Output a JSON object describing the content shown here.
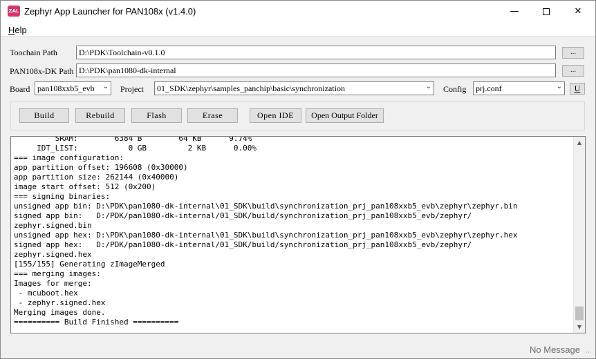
{
  "window": {
    "title": "Zephyr App Launcher for PAN108x (v1.4.0)",
    "icon_text": "ZAL",
    "icon_color": "#d6336c"
  },
  "menu": {
    "help_prefix": "H",
    "help_rest": "elp"
  },
  "toolchain": {
    "label": "Toochain Path",
    "value": "D:\\PDK\\Toolchain-v0.1.0",
    "browse": "..."
  },
  "pdk": {
    "label": "PAN108x-DK Path",
    "value": "D:\\PDK\\pan1080-dk-internal",
    "browse": "..."
  },
  "board": {
    "label": "Board",
    "value": "pan108xxb5_evb"
  },
  "project": {
    "label": "Project",
    "value": "01_SDK\\zephyr\\samples_panchip\\basic\\synchronization"
  },
  "config": {
    "label": "Config",
    "value": "prj.conf",
    "u_button": "U"
  },
  "buttons": {
    "build": "Build",
    "rebuild": "Rebuild",
    "flash": "Flash",
    "erase": "Erase",
    "open_ide": "Open IDE",
    "open_output": "Open Output Folder"
  },
  "console": {
    "lines": [
      "         SRAM:        6384 B        64 KB      9.74%",
      "     IDT_LIST:           0 GB         2 KB      0.00%",
      "=== image configuration:",
      "app partition offset: 196608 (0x30000)",
      "app partition size: 262144 (0x40000)",
      "image start offset: 512 (0x200)",
      "=== signing binaries:",
      "unsigned app bin: D:\\PDK\\pan1080-dk-internal\\01_SDK\\build\\synchronization_prj_pan108xxb5_evb\\zephyr\\zephyr.bin",
      "signed app bin:   D:/PDK/pan1080-dk-internal/01_SDK/build/synchronization_prj_pan108xxb5_evb/zephyr/",
      "zephyr.signed.bin",
      "unsigned app hex: D:\\PDK\\pan1080-dk-internal\\01_SDK\\build\\synchronization_prj_pan108xxb5_evb\\zephyr\\zephyr.hex",
      "signed app hex:   D:/PDK/pan1080-dk-internal/01_SDK/build/synchronization_prj_pan108xxb5_evb/zephyr/",
      "zephyr.signed.hex",
      "[155/155] Generating zImageMerged",
      "=== merging images:",
      "Images for merge:",
      " - mcuboot.hex",
      " - zephyr.signed.hex",
      "Merging images done.",
      "========== Build Finished =========="
    ]
  },
  "status": {
    "message": "No Message"
  }
}
